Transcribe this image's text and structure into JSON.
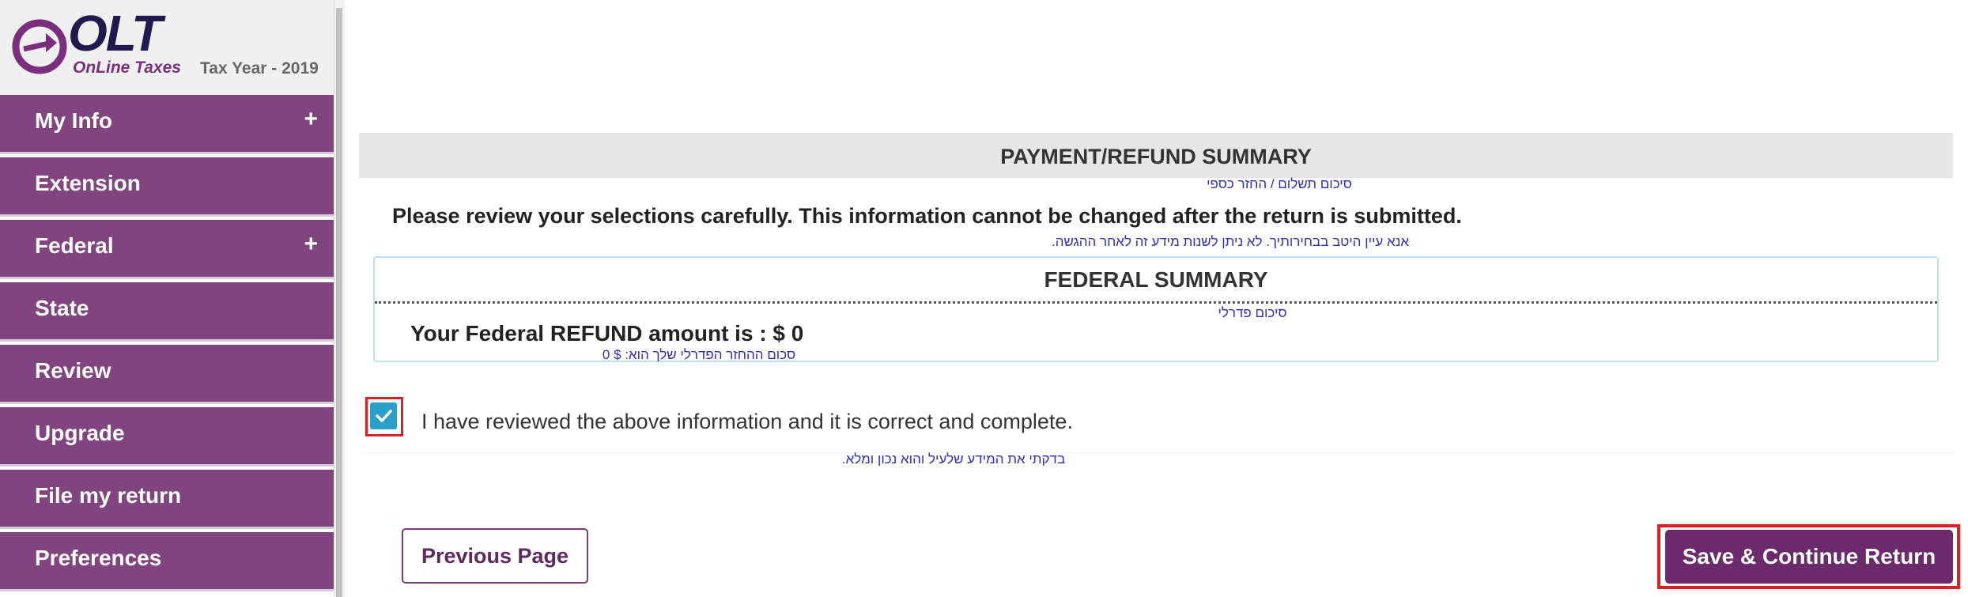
{
  "sidebar": {
    "logo": {
      "brand": "OLT",
      "tagline": "OnLine Taxes"
    },
    "tax_year": "Tax Year - 2019",
    "items": [
      {
        "label": "My Info",
        "expand": "+"
      },
      {
        "label": "Extension",
        "expand": ""
      },
      {
        "label": "Federal",
        "expand": "+"
      },
      {
        "label": "State",
        "expand": ""
      },
      {
        "label": "Review",
        "expand": ""
      },
      {
        "label": "Upgrade",
        "expand": ""
      },
      {
        "label": "File my return",
        "expand": ""
      },
      {
        "label": "Preferences",
        "expand": ""
      }
    ]
  },
  "main": {
    "summary_title": "PAYMENT/REFUND SUMMARY",
    "summary_title_heb": "סיכום תשלום / החזר כספי",
    "review_note": "Please review your selections carefully. This information cannot be changed after the return is submitted.",
    "review_note_heb": "אנא עיין היטב בבחירותיך. לא ניתן לשנות מידע זה לאחר ההגשה.",
    "federal": {
      "title": "FEDERAL SUMMARY",
      "title_heb": "סיכום פדרלי",
      "amount_text": "Your Federal REFUND amount is : $ 0",
      "amount_heb": "סכום ההחזר הפדרלי שלך הוא: $ 0"
    },
    "confirm": {
      "checked": true,
      "label": "I have reviewed the above information and it is correct and complete.",
      "label_heb": "בדקתי את המידע שלעיל והוא נכון ומלא."
    },
    "buttons": {
      "previous": "Previous Page",
      "save_continue": "Save & Continue Return"
    }
  },
  "colors": {
    "nav_bg": "#80447f",
    "primary_button": "#6b2a6b",
    "checkbox": "#2aa0c8",
    "highlight": "#e02020",
    "hebrew_text": "#2f2fb8"
  }
}
